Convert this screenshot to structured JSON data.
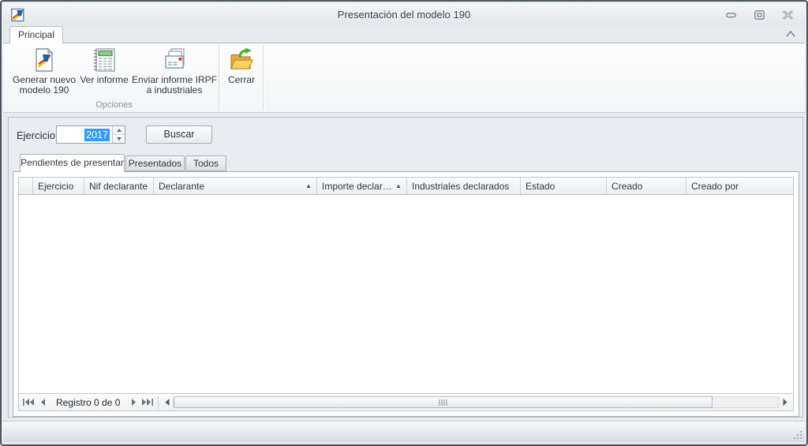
{
  "window": {
    "title": "Presentación del modelo 190"
  },
  "ribbon": {
    "tab_label": "Principal",
    "group_caption": "Opciones",
    "buttons": [
      {
        "label": "Generar nuevo modelo 190",
        "icon": "new-model-document-icon"
      },
      {
        "label": "Ver informe",
        "icon": "report-notepad-icon"
      },
      {
        "label": "Enviar informe IRPF a industriales",
        "icon": "send-mail-icon"
      },
      {
        "label": "Cerrar",
        "icon": "exit-folder-icon"
      }
    ]
  },
  "search": {
    "ejercicio_label": "Ejercicio:",
    "ejercicio_value": "2017",
    "buscar_label": "Buscar"
  },
  "tabs": [
    {
      "label": "Pendientes de presentar",
      "active": true
    },
    {
      "label": "Presentados",
      "active": false
    },
    {
      "label": "Todos",
      "active": false
    }
  ],
  "grid": {
    "columns": [
      {
        "label": "Ejercicio",
        "sorted": "none"
      },
      {
        "label": "Nif declarante",
        "sorted": "none"
      },
      {
        "label": "Declarante",
        "sorted": "asc"
      },
      {
        "label": "Importe declarado",
        "sorted": "asc"
      },
      {
        "label": "Industriales declarados",
        "sorted": "none"
      },
      {
        "label": "Estado",
        "sorted": "none"
      },
      {
        "label": "Creado",
        "sorted": "none"
      },
      {
        "label": "Creado por",
        "sorted": "none"
      }
    ],
    "rows": [],
    "sort_glyph": "▲"
  },
  "navigator": {
    "record_label": "Registro 0 de 0"
  },
  "colors": {
    "selection_blue": "#3399ff",
    "folder_yellow": "#f6c14a",
    "arrow_green": "#4fae35",
    "logo_blue": "#1f5fa9",
    "logo_red": "#cc2a1d",
    "logo_yellow": "#f0c020",
    "notepad_green": "#8fca8a",
    "window_border": "#4d555c"
  }
}
